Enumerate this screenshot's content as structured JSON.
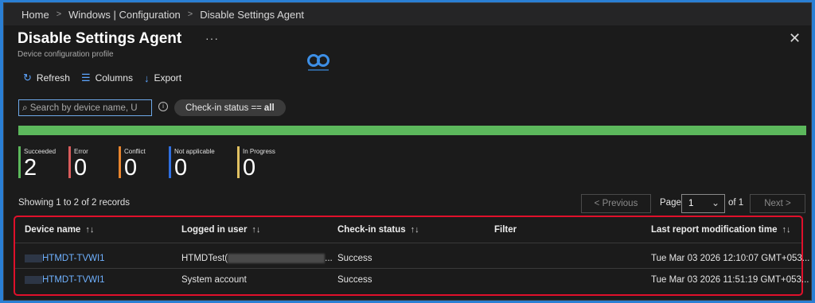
{
  "breadcrumb": [
    "Home",
    "Windows | Configuration",
    "Disable Settings Agent"
  ],
  "header": {
    "title": "Disable Settings Agent",
    "more": "···",
    "subtitle": "Device configuration profile",
    "close": "✕"
  },
  "toolbar": {
    "refresh": "Refresh",
    "columns": "Columns",
    "export": "Export"
  },
  "search": {
    "placeholder": "Search by device name, U"
  },
  "filter_pill": {
    "prefix": "Check-in status ==",
    "value": "all"
  },
  "progress": {
    "succeeded_fraction": 1.0,
    "color": "#5cb85c"
  },
  "stats": [
    {
      "label": "Succeeded",
      "value": "2",
      "color": "#5cb85c"
    },
    {
      "label": "Error",
      "value": "0",
      "color": "#d95c5c"
    },
    {
      "label": "Conflict",
      "value": "0",
      "color": "#e8852e"
    },
    {
      "label": "Not applicable",
      "value": "0",
      "color": "#2f6fe0"
    },
    {
      "label": "In Progress",
      "value": "0",
      "color": "#e0c062"
    }
  ],
  "records": "Showing 1 to 2 of 2 records",
  "pager": {
    "previous": "< Previous",
    "page_label": "Page",
    "current": "1",
    "of": "of 1",
    "next": "Next >"
  },
  "table": {
    "columns": [
      "Device name",
      "Logged in user",
      "Check-in status",
      "Filter",
      "Last report modification time"
    ],
    "rows": [
      {
        "device": "HTMDT-TVWI1",
        "user": "HTMDTest(",
        "user_suffix": "...",
        "status": "Success",
        "filter": "",
        "time": "Tue Mar 03 2026 12:10:07 GMT+053..."
      },
      {
        "device": "HTMDT-TVWI1",
        "user": "System account",
        "user_suffix": "",
        "status": "Success",
        "filter": "",
        "time": "Tue Mar 03 2026 11:51:19 GMT+053..."
      }
    ]
  }
}
